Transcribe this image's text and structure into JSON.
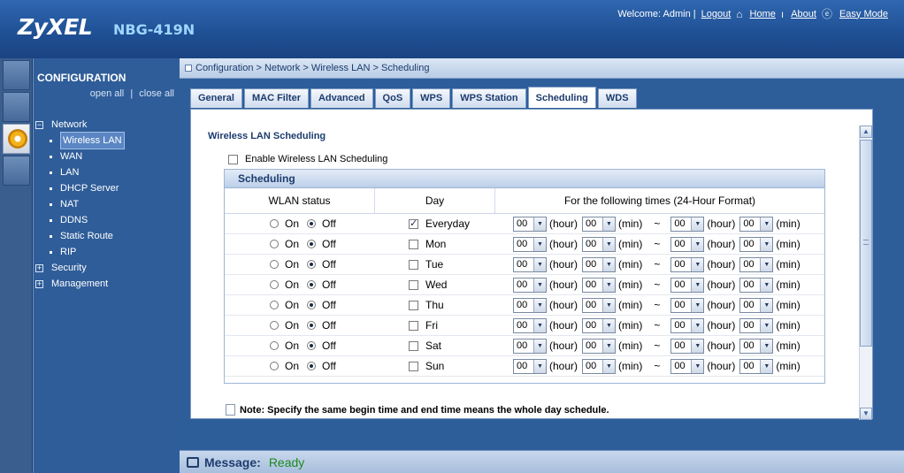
{
  "header": {
    "brand": "ZyXEL",
    "model": "NBG-419N",
    "welcome": "Welcome: Admin |",
    "logout": "Logout",
    "home": "Home",
    "about": "About",
    "easy_mode": "Easy Mode"
  },
  "nav": {
    "title": "CONFIGURATION",
    "open_all": "open all",
    "divider": "|",
    "close_all": "close all",
    "items": [
      {
        "label": "Network",
        "type": "group",
        "expanded": true
      },
      {
        "label": "Wireless LAN",
        "type": "child",
        "selected": true
      },
      {
        "label": "WAN",
        "type": "child"
      },
      {
        "label": "LAN",
        "type": "child"
      },
      {
        "label": "DHCP Server",
        "type": "child"
      },
      {
        "label": "NAT",
        "type": "child"
      },
      {
        "label": "DDNS",
        "type": "child"
      },
      {
        "label": "Static Route",
        "type": "child"
      },
      {
        "label": "RIP",
        "type": "child"
      },
      {
        "label": "Security",
        "type": "group",
        "expanded": false
      },
      {
        "label": "Management",
        "type": "group",
        "expanded": false
      }
    ]
  },
  "breadcrumb": "Configuration > Network > Wireless LAN > Scheduling",
  "tabs": [
    {
      "label": "General"
    },
    {
      "label": "MAC Filter"
    },
    {
      "label": "Advanced"
    },
    {
      "label": "QoS"
    },
    {
      "label": "WPS"
    },
    {
      "label": "WPS Station"
    },
    {
      "label": "Scheduling",
      "active": true
    },
    {
      "label": "WDS"
    }
  ],
  "content": {
    "title": "Wireless LAN Scheduling",
    "enable_label": "Enable Wireless LAN Scheduling",
    "section": "Scheduling",
    "columns": {
      "status": "WLAN status",
      "day": "Day",
      "times": "For the following times (24-Hour Format)"
    },
    "on_label": "On",
    "off_label": "Off",
    "hour_label": "(hour)",
    "min_label": "(min)",
    "tilde": "~",
    "rows": [
      {
        "day": "Everyday",
        "checked": true,
        "status": "off",
        "times": [
          "00",
          "00",
          "00",
          "00"
        ]
      },
      {
        "day": "Mon",
        "checked": false,
        "status": "off",
        "times": [
          "00",
          "00",
          "00",
          "00"
        ]
      },
      {
        "day": "Tue",
        "checked": false,
        "status": "off",
        "times": [
          "00",
          "00",
          "00",
          "00"
        ]
      },
      {
        "day": "Wed",
        "checked": false,
        "status": "off",
        "times": [
          "00",
          "00",
          "00",
          "00"
        ]
      },
      {
        "day": "Thu",
        "checked": false,
        "status": "off",
        "times": [
          "00",
          "00",
          "00",
          "00"
        ]
      },
      {
        "day": "Fri",
        "checked": false,
        "status": "off",
        "times": [
          "00",
          "00",
          "00",
          "00"
        ]
      },
      {
        "day": "Sat",
        "checked": false,
        "status": "off",
        "times": [
          "00",
          "00",
          "00",
          "00"
        ]
      },
      {
        "day": "Sun",
        "checked": false,
        "status": "off",
        "times": [
          "00",
          "00",
          "00",
          "00"
        ]
      }
    ],
    "note": "Note: Specify the same begin time and end time means the whole day schedule."
  },
  "message": {
    "label": "Message:",
    "value": "Ready"
  },
  "icons": {
    "home": "home-icon",
    "about": "info-icon",
    "easy_mode": "easy-mode-icon",
    "config": "gear-icon",
    "message": "message-icon"
  },
  "colors": {
    "header": "#1f4f93",
    "nav": "#2f5d99",
    "ready": "#1c8a1c"
  }
}
